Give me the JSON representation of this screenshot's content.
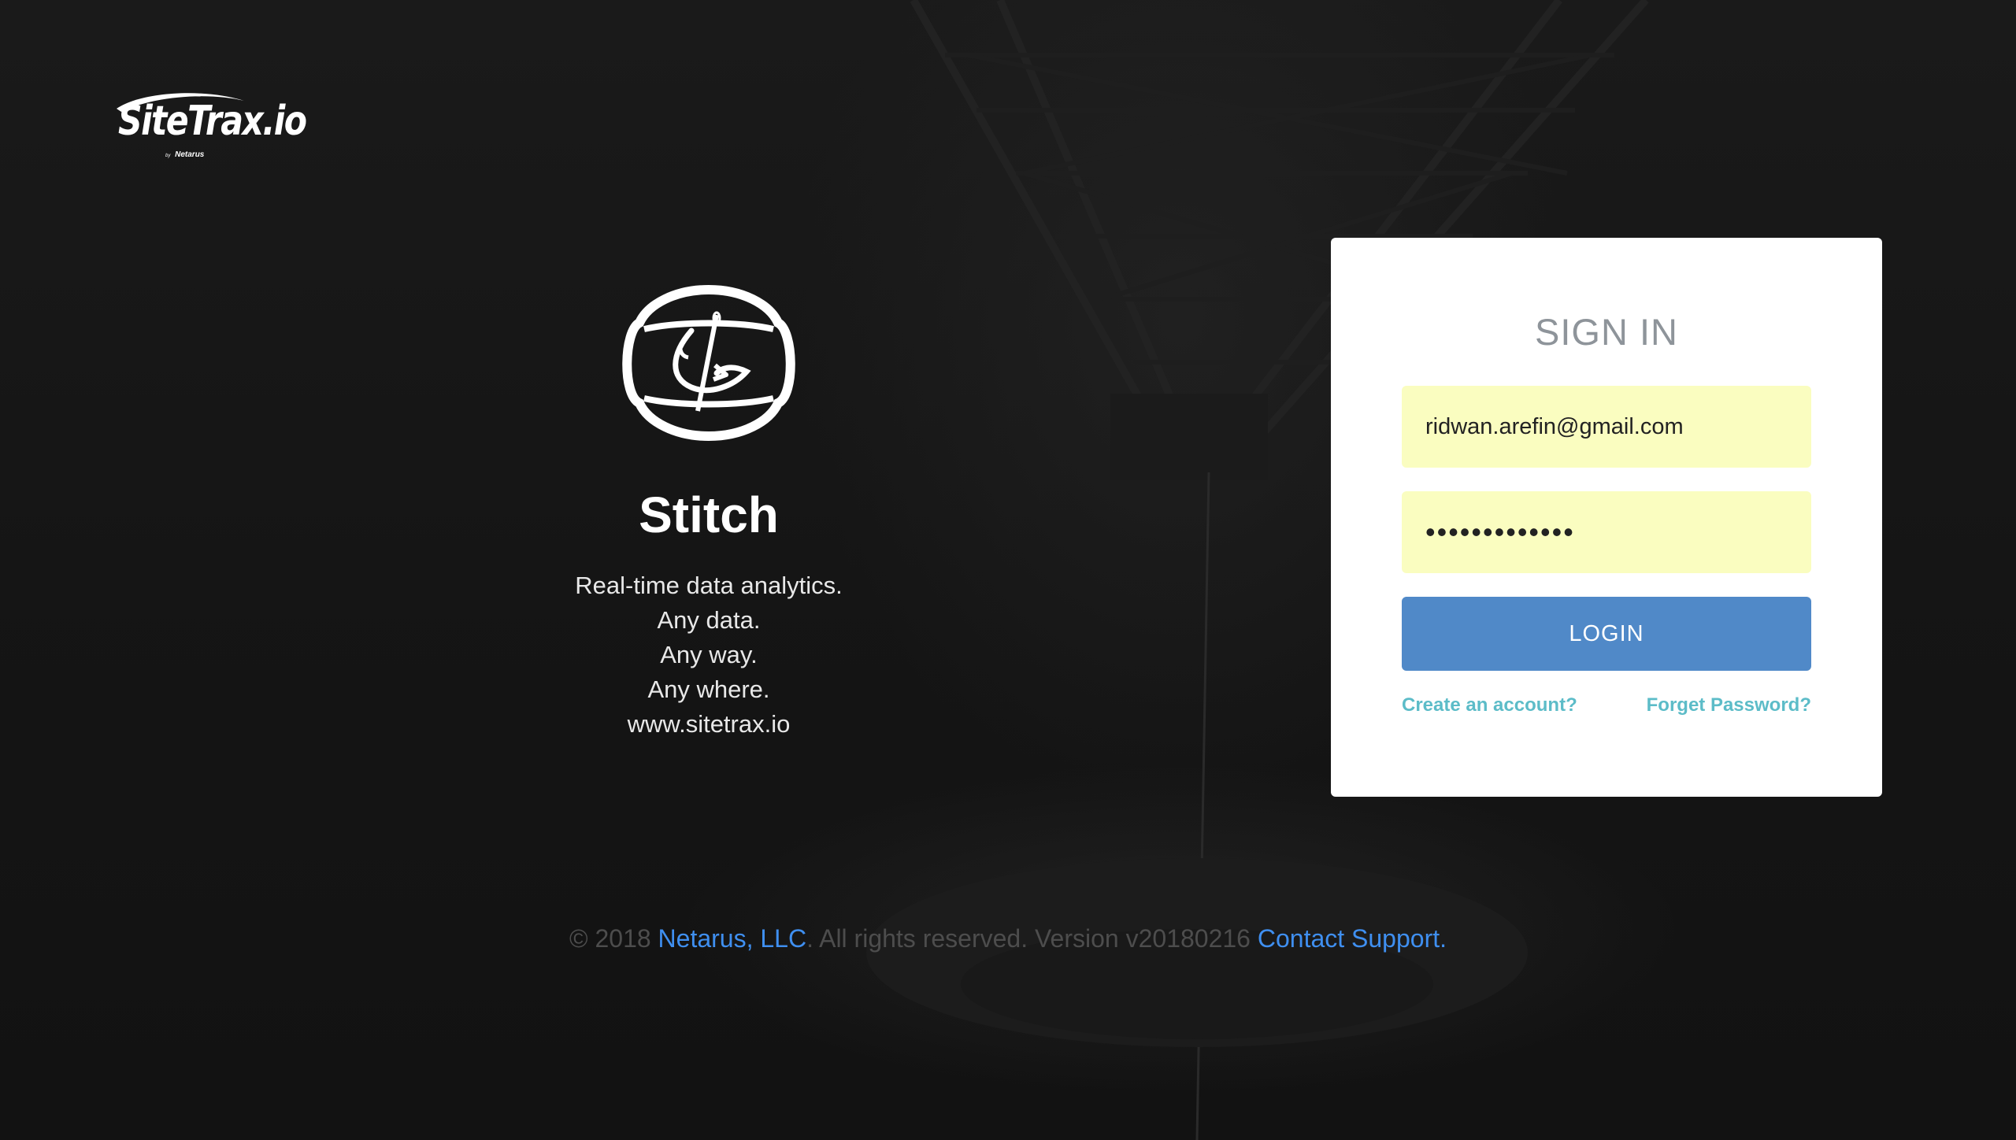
{
  "brand": {
    "logo_text": "SiteTrax.io",
    "logo_by": "by",
    "logo_company": "Netarus"
  },
  "hero": {
    "icon": "stitch-needle-icon",
    "app_name": "Stitch",
    "tagline_lines": [
      "Real-time data analytics.",
      "Any data.",
      "Any way.",
      "Any where.",
      "www.sitetrax.io"
    ]
  },
  "login": {
    "title": "SIGN IN",
    "email_value": "ridwan.arefin@gmail.com",
    "password_value": "•••••••••••••",
    "login_label": "LOGIN",
    "create_account_label": "Create an account?",
    "forgot_password_label": "Forget Password?"
  },
  "footer": {
    "copyright_prefix": "© 2018 ",
    "company_link": "Netarus, LLC",
    "rights_text": ". All rights reserved. Version v20180216 ",
    "support_link": "Contact Support."
  },
  "colors": {
    "background": "#141414",
    "card": "#ffffff",
    "field_fill": "#fafdc0",
    "login_button": "#5089c8",
    "card_link": "#5cbcc8",
    "footer_link": "#3f8ff0",
    "title_gray": "#8e949a"
  }
}
